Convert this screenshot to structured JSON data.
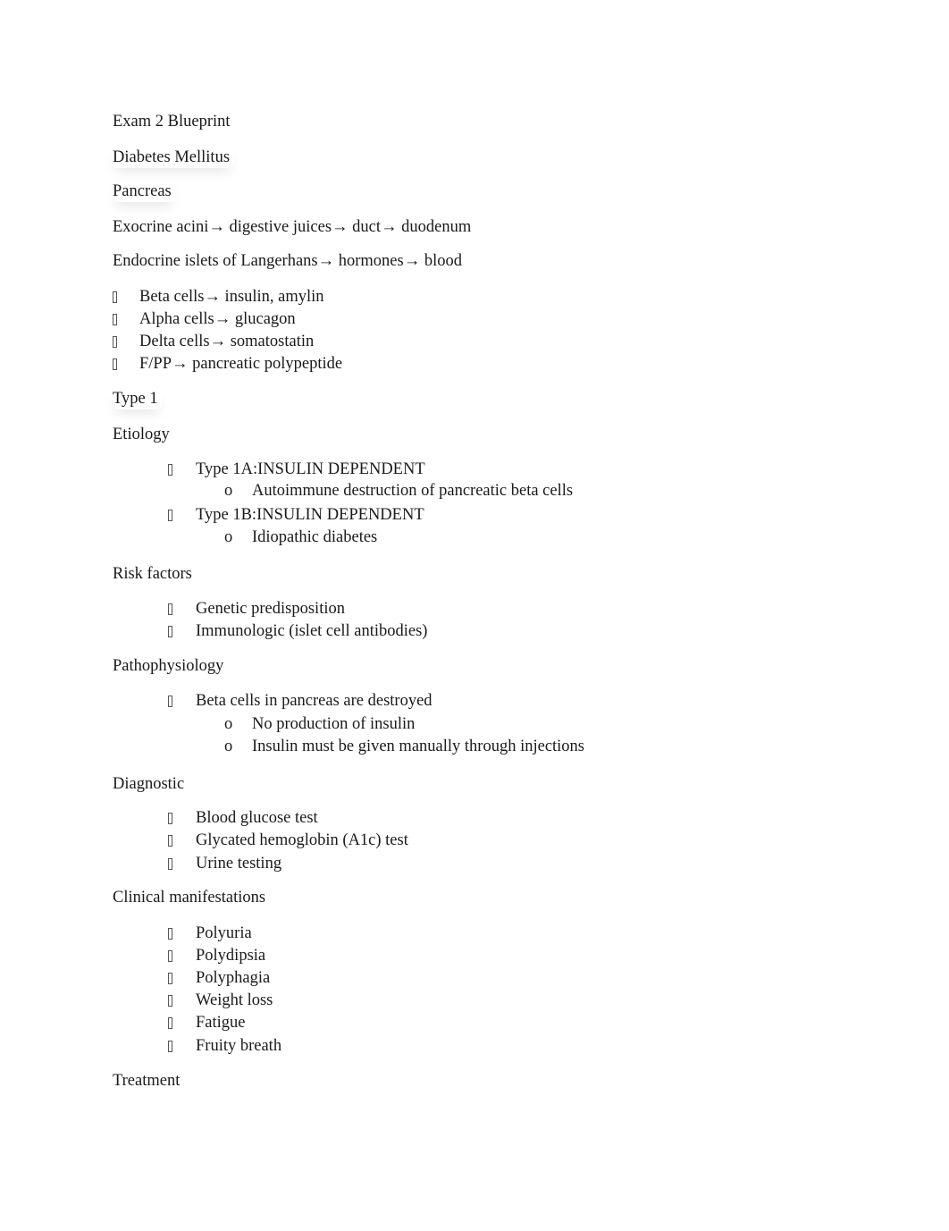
{
  "document": {
    "title": "Exam 2 Blueprint",
    "topic": "Diabetes Mellitus",
    "section_pancreas": {
      "heading": "Pancreas",
      "exocrine": "Exocrine acini→ digestive juices→ duct→ duodenum",
      "endocrine": "Endocrine islets of Langerhans→ hormones→ blood",
      "cells": [
        "Beta cells→ insulin, amylin",
        "Alpha cells→ glucagon",
        "Delta cells→ somatostatin",
        "F/PP→ pancreatic polypeptide"
      ]
    },
    "type1": {
      "heading": "Type 1",
      "etiology": {
        "heading": "Etiology",
        "items": [
          {
            "label": "Type 1A:INSULIN DEPENDENT",
            "sub": [
              "Autoimmune destruction of pancreatic beta cells"
            ]
          },
          {
            "label": "Type 1B:INSULIN DEPENDENT",
            "sub": [
              "Idiopathic diabetes"
            ]
          }
        ]
      },
      "risk_factors": {
        "heading": "Risk factors",
        "items": [
          "Genetic predisposition",
          "Immunologic (islet cell antibodies)"
        ]
      },
      "pathophysiology": {
        "heading": "Pathophysiology",
        "items": [
          {
            "label": "Beta cells in pancreas are destroyed",
            "sub": [
              "No production of insulin",
              "Insulin must be given manually through injections"
            ]
          }
        ]
      },
      "diagnostic": {
        "heading": "Diagnostic",
        "items": [
          "Blood glucose test",
          "Glycated hemoglobin (A1c) test",
          "Urine testing"
        ]
      },
      "clinical_manifestations": {
        "heading": "Clinical manifestations",
        "items": [
          "Polyuria",
          "Polydipsia",
          "Polyphagia",
          "Weight loss",
          "Fatigue",
          "Fruity breath"
        ]
      },
      "treatment": {
        "heading": "Treatment"
      }
    },
    "sub_bullet_marker": "o"
  }
}
